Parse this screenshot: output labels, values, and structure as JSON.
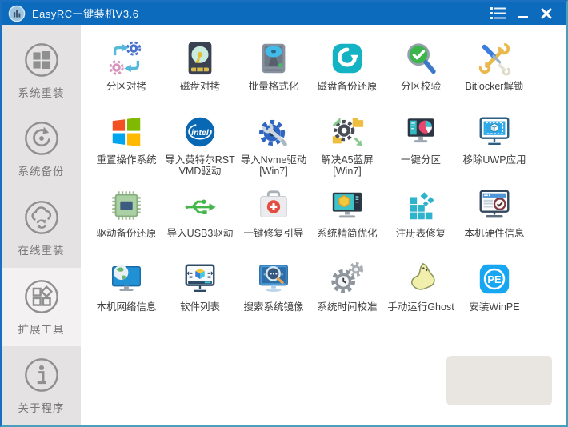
{
  "window": {
    "title": "EasyRC一键装机V3.6"
  },
  "titlebar": {
    "buttons": [
      {
        "id": "menu",
        "name": "menu-list-icon"
      },
      {
        "id": "minimize",
        "name": "minimize-icon"
      },
      {
        "id": "close",
        "name": "close-icon"
      }
    ]
  },
  "sidebar": {
    "selected_index": 3,
    "items": [
      {
        "id": "system-reinstall",
        "label": "系统重装",
        "icon": "windows-logo-icon",
        "selected": false
      },
      {
        "id": "system-backup",
        "label": "系统备份",
        "icon": "restore-arrow-icon",
        "selected": false
      },
      {
        "id": "online-reinstall",
        "label": "在线重装",
        "icon": "cloud-reload-icon",
        "selected": false
      },
      {
        "id": "extension-tools",
        "label": "扩展工具",
        "icon": "extension-grid-icon",
        "selected": true
      },
      {
        "id": "about-program",
        "label": "关于程序",
        "icon": "info-icon",
        "selected": false
      }
    ]
  },
  "tools": [
    {
      "id": "partition-copy",
      "label": "分区对拷",
      "icon": "partition-copy-icon"
    },
    {
      "id": "disk-copy",
      "label": "磁盘对拷",
      "icon": "disk-copy-icon"
    },
    {
      "id": "batch-format",
      "label": "批量格式化",
      "icon": "batch-format-icon"
    },
    {
      "id": "disk-backup-restore",
      "label": "磁盘备份还原",
      "icon": "disk-backup-icon"
    },
    {
      "id": "partition-verify",
      "label": "分区校验",
      "icon": "partition-verify-icon"
    },
    {
      "id": "bitlocker-unlock",
      "label": "Bitlocker解锁",
      "icon": "bitlocker-unlock-icon"
    },
    {
      "id": "reset-os",
      "label": "重置操作系统",
      "icon": "windows-color-icon"
    },
    {
      "id": "intel-rst-vmd",
      "label": "导入英特尔RST",
      "label2": "VMD驱动",
      "icon": "intel-logo-icon",
      "icon_text": "intel"
    },
    {
      "id": "nvme-driver-win7",
      "label": "导入Nvme驱动",
      "label2": "[Win7]",
      "icon": "gear-wrench-icon"
    },
    {
      "id": "fix-a5-bluescreen",
      "label": "解决A5蓝屏",
      "label2": "[Win7]",
      "icon": "gear-folders-icon"
    },
    {
      "id": "one-key-partition",
      "label": "一键分区",
      "icon": "monitor-pie-icon"
    },
    {
      "id": "remove-uwp",
      "label": "移除UWP应用",
      "icon": "monitor-uwp-box-icon"
    },
    {
      "id": "driver-backup",
      "label": "驱动备份还原",
      "icon": "cpu-chip-icon"
    },
    {
      "id": "import-usb3",
      "label": "导入USB3驱动",
      "icon": "usb-symbol-icon"
    },
    {
      "id": "boot-repair",
      "label": "一键修复引导",
      "icon": "first-aid-kit-icon"
    },
    {
      "id": "system-optimize",
      "label": "系统精简优化",
      "icon": "monitor-hexagon-icon"
    },
    {
      "id": "registry-repair",
      "label": "注册表修复",
      "icon": "registry-blocks-icon"
    },
    {
      "id": "hardware-info",
      "label": "本机硬件信息",
      "icon": "monitor-check-icon"
    },
    {
      "id": "network-info",
      "label": "本机网络信息",
      "icon": "monitor-globe-icon"
    },
    {
      "id": "software-list",
      "label": "软件列表",
      "icon": "monitor-cube-icon"
    },
    {
      "id": "search-system-image",
      "label": "搜索系统镜像",
      "icon": "monitor-search-icon"
    },
    {
      "id": "time-calibration",
      "label": "系统时间校准",
      "icon": "gear-clock-icon"
    },
    {
      "id": "run-ghost",
      "label": "手动运行Ghost",
      "icon": "ghost-icon"
    },
    {
      "id": "install-winpe",
      "label": "安装WinPE",
      "icon": "winpe-badge-icon",
      "icon_text": "PE"
    }
  ],
  "colors": {
    "titlebar": "#0d6bbe",
    "sidebar_bg": "#e4e2e3",
    "sidebar_selected_bg": "#f3f1f2",
    "sidebar_icon": "#8f8f8f",
    "grid_label": "#3f3f3f",
    "watermark_bg": "#e9e6e1",
    "accent_teal": "#14b3c4"
  }
}
